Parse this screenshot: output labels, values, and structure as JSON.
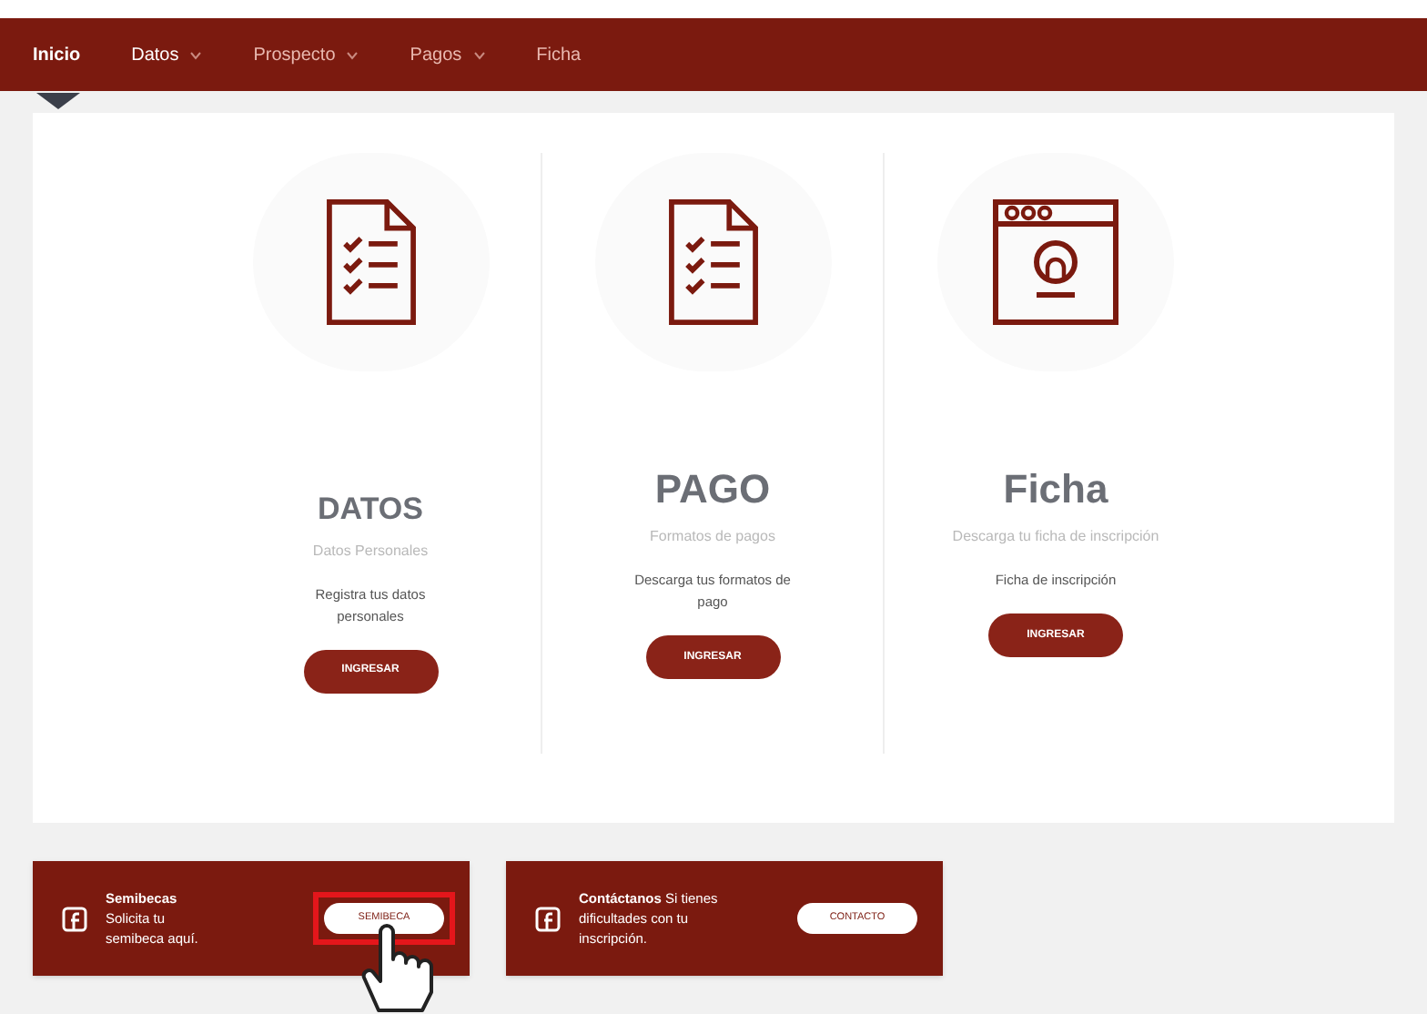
{
  "nav": [
    {
      "label": "Inicio",
      "selected": true,
      "dropdown": false
    },
    {
      "label": "Datos",
      "selected": false,
      "dropdown": true
    },
    {
      "label": "Prospecto",
      "selected": false,
      "dropdown": true
    },
    {
      "label": "Pagos",
      "selected": false,
      "dropdown": true
    },
    {
      "label": "Ficha",
      "selected": false,
      "dropdown": false
    }
  ],
  "cards": [
    {
      "kind": "checklist",
      "title": "DATOS",
      "subtitle": "Datos Personales",
      "description": "Registra tus datos personales",
      "button": "INGRESAR"
    },
    {
      "kind": "checklist",
      "title": "PAGO",
      "subtitle": "Formatos de pagos",
      "description": "Descarga tus formatos de pago",
      "button": "INGRESAR"
    },
    {
      "kind": "profile",
      "title": "Ficha",
      "subtitle": "Descarga tu ficha de inscripción",
      "description": "Ficha de inscripción",
      "button": "INGRESAR"
    }
  ],
  "banners": [
    {
      "text": "**Semibecas** Solicita tu semibeca aquí.",
      "button": "SEMIBECA",
      "highlighted": true
    },
    {
      "text": "**Contáctanos** Si tienes dificultades con tu inscripción.",
      "button": "CONTACTO",
      "highlighted": false
    }
  ]
}
